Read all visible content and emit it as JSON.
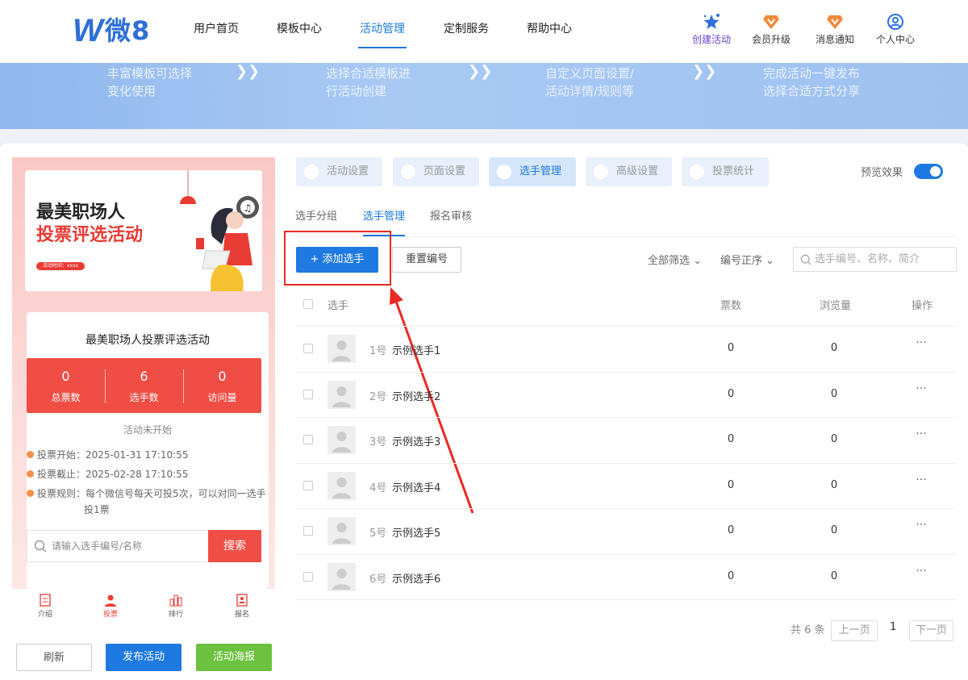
{
  "header": {
    "logo_w": "W",
    "logo_text": "微8",
    "nav": [
      "用户首页",
      "模板中心",
      "活动管理",
      "定制服务",
      "帮助中心"
    ],
    "actions": [
      {
        "label": "创建活动",
        "icon": "star-sparkle-icon"
      },
      {
        "label": "会员升级",
        "icon": "vip-shield-icon"
      },
      {
        "label": "消息通知",
        "icon": "bell-badge-icon"
      },
      {
        "label": "个人中心",
        "icon": "user-circle-icon"
      }
    ]
  },
  "banner": {
    "steps": [
      {
        "l1": "丰富模板可选择",
        "l2": "变化使用"
      },
      {
        "l1": "选择合适模板进",
        "l2": "行活动创建"
      },
      {
        "l1": "自定义页面设置/",
        "l2": "活动详情/规则等"
      },
      {
        "l1": "完成活动一键发布",
        "l2": "选择合适方式分享"
      }
    ]
  },
  "phone": {
    "poster_line1": "最美职场人",
    "poster_line2": "投票评选活动",
    "poster_tag": "活动时间：xxxx",
    "title": "最美职场人投票评选活动",
    "stats": [
      {
        "value": "0",
        "label": "总票数"
      },
      {
        "value": "6",
        "label": "选手数"
      },
      {
        "value": "0",
        "label": "访问量"
      }
    ],
    "status": "活动未开始",
    "info": [
      "投票开始：2025-01-31 17:10:55",
      "投票截止：2025-02-28 17:10:55",
      "投票规则：每个微信号每天可投5次，可以对同一选手",
      "投1票"
    ],
    "search_placeholder": "请输入选手编号/名称",
    "search_btn": "搜索",
    "tabbar": [
      "介绍",
      "投票",
      "排行",
      "报名"
    ]
  },
  "bottom_buttons": {
    "refresh": "刷新",
    "publish": "发布活动",
    "poster": "活动海报"
  },
  "settings_tabs": [
    "活动设置",
    "页面设置",
    "选手管理",
    "高级设置",
    "投票统计"
  ],
  "preview_label": "预览效果",
  "subtabs": [
    "选手分组",
    "选手管理",
    "报名审核"
  ],
  "toolbar": {
    "add": "+ 添加选手",
    "reset": "重置编号",
    "filter": "全部筛选",
    "sort": "编号正序",
    "search_placeholder": "选手编号、名称、简介"
  },
  "table": {
    "headers": [
      "选手",
      "票数",
      "浏览量",
      "操作"
    ],
    "rows": [
      {
        "num": "1号",
        "name": "示例选手1",
        "votes": "0",
        "views": "0"
      },
      {
        "num": "2号",
        "name": "示例选手2",
        "votes": "0",
        "views": "0"
      },
      {
        "num": "3号",
        "name": "示例选手3",
        "votes": "0",
        "views": "0"
      },
      {
        "num": "4号",
        "name": "示例选手4",
        "votes": "0",
        "views": "0"
      },
      {
        "num": "5号",
        "name": "示例选手5",
        "votes": "0",
        "views": "0"
      },
      {
        "num": "6号",
        "name": "示例选手6",
        "votes": "0",
        "views": "0"
      }
    ],
    "ops_glyph": "···"
  },
  "pagination": {
    "total": "共 6 条",
    "prev": "上一页",
    "page": "1",
    "next": "下一页"
  },
  "colors": {
    "accent": "#1e79e0",
    "red": "#f04e45",
    "green": "#6cc13f",
    "highlight": "#e82a22"
  }
}
